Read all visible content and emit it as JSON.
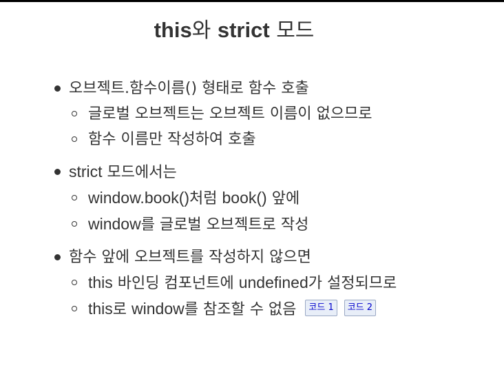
{
  "title": {
    "part1": "this",
    "part2": "와 ",
    "part3": "strict",
    "part4": " 모드"
  },
  "bullets": [
    {
      "text": "오브젝트.함수이름() 형태로 함수 호출",
      "subs": [
        "글로벌 오브젝트는 오브젝트 이름이 없으므로",
        "함수 이름만 작성하여 호출"
      ]
    },
    {
      "text_latin": "strict",
      "text_rest": " 모드에서는",
      "subs": [
        {
          "latin1": "window.book()",
          "ko1": "처럼 ",
          "latin2": "book()",
          "ko2": " 앞에"
        },
        {
          "latin1": "window",
          "ko1": "를 글로벌 오브젝트로 작성"
        }
      ]
    },
    {
      "text": "함수 앞에 오브젝트를 작성하지 않으면",
      "subs": [
        {
          "latin1": "this",
          "ko1": " 바인딩 컴포넌트에 ",
          "latin2": "undefined",
          "ko2": "가 설정되므로"
        },
        {
          "latin1": "this",
          "ko1": "로 ",
          "latin2": "window",
          "ko2": "를 참조할 수 없음"
        }
      ]
    }
  ],
  "code_buttons": [
    "코드 1",
    "코드 2"
  ]
}
